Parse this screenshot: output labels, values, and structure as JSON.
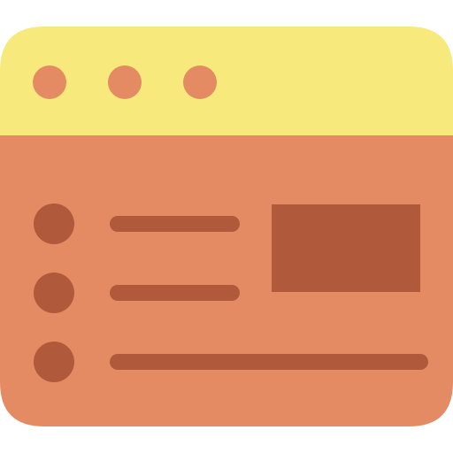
{
  "icon": {
    "name": "browser-window-list-icon",
    "colors": {
      "titlebar": "#F7E97C",
      "window_body": "#E48B63",
      "window_dots": "#E48B63",
      "content_marks": "#B05A3B"
    },
    "window_controls": [
      "dot",
      "dot",
      "dot"
    ],
    "list_items": 3,
    "has_image_placeholder": true
  }
}
